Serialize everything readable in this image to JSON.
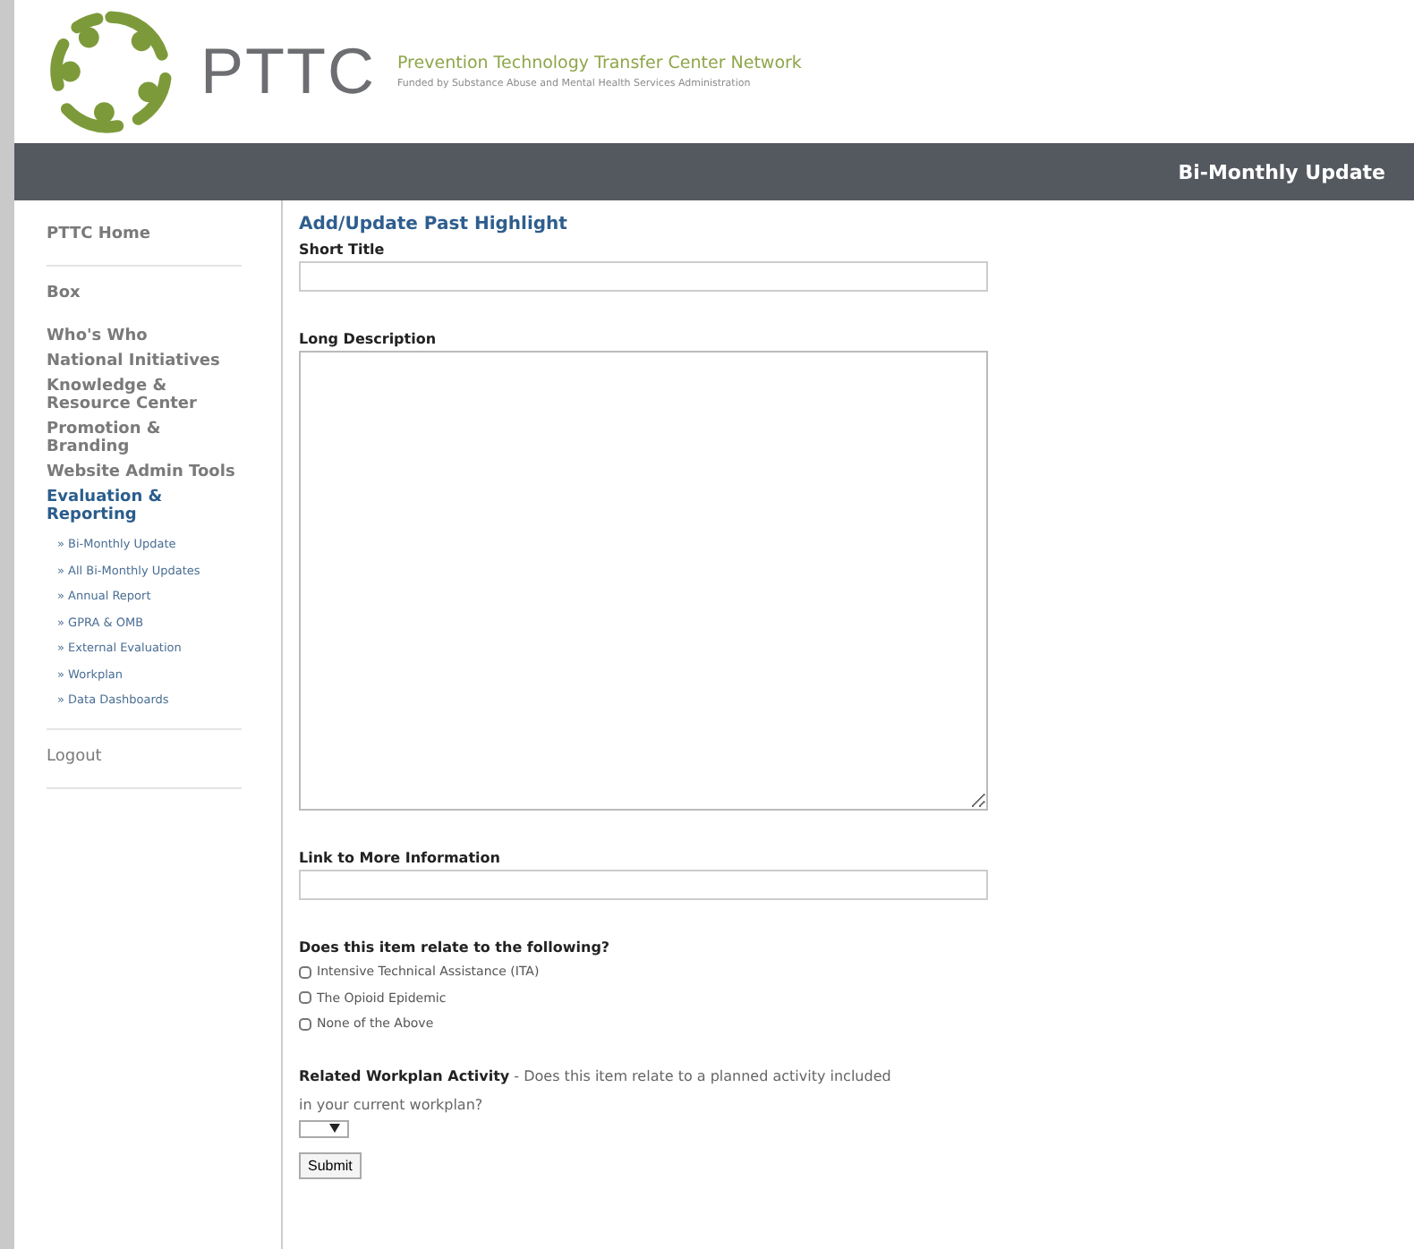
{
  "header": {
    "logo_text": "PTTC",
    "org_name": "Prevention Technology Transfer Center Network",
    "tagline": "Funded by Substance Abuse and Mental Health Services Administration"
  },
  "nav_bar": {
    "title": "Bi-Monthly Update"
  },
  "sidebar": {
    "groups": [
      {
        "items": [
          {
            "label": "PTTC Home",
            "selected": false
          }
        ]
      },
      {
        "items": [
          {
            "label": "Box",
            "selected": false
          },
          {
            "label": "Who's Who",
            "selected": false
          },
          {
            "label": "National Initiatives",
            "selected": false
          },
          {
            "label": "Knowledge & Resource Center",
            "selected": false
          },
          {
            "label": "Promotion & Branding",
            "selected": false
          },
          {
            "label": "Website Admin Tools",
            "selected": false
          },
          {
            "label": "Evaluation & Reporting",
            "selected": true,
            "children": [
              {
                "label": "» Bi-Monthly Update"
              },
              {
                "label": "» All Bi-Monthly Updates"
              },
              {
                "label": "» Annual Report"
              },
              {
                "label": "» GPRA & OMB"
              },
              {
                "label": "» External Evaluation"
              },
              {
                "label": "» Workplan"
              },
              {
                "label": "» Data Dashboards"
              }
            ]
          }
        ]
      },
      {
        "items": [
          {
            "label": "Logout",
            "selected": false,
            "kind": "logout"
          }
        ]
      }
    ]
  },
  "form": {
    "title": "Add/Update Past Highlight",
    "fields": [
      {
        "kind": "input",
        "label": "Short Title"
      },
      {
        "kind": "textarea",
        "label": "Long Description"
      },
      {
        "kind": "input",
        "label": "Link to More Information"
      }
    ],
    "question": "Does this item relate to the following?",
    "options": [
      {
        "label": "Intensive Technical Assistance (ITA)",
        "checked": false
      },
      {
        "label": "The Opioid Epidemic",
        "checked": false
      },
      {
        "label": "None of the Above",
        "checked": false
      }
    ],
    "workplan_label": "Related Workplan Activity",
    "workplan_text": "- Does this item relate to a planned activity included in your current workplan?",
    "submit": "Submit"
  }
}
